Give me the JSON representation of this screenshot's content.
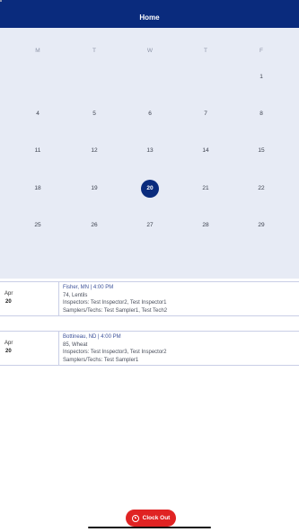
{
  "header": {
    "title": "Home"
  },
  "calendar": {
    "weekdays": [
      "M",
      "T",
      "W",
      "T",
      "F"
    ],
    "weeks": [
      [
        "",
        "",
        "",
        "",
        "1"
      ],
      [
        "4",
        "5",
        "6",
        "7",
        "8"
      ],
      [
        "11",
        "12",
        "13",
        "14",
        "15"
      ],
      [
        "18",
        "19",
        "20",
        "21",
        "22"
      ],
      [
        "25",
        "26",
        "27",
        "28",
        "29"
      ]
    ],
    "selected_day": "20"
  },
  "events": [
    {
      "month": "Apr",
      "day": "20",
      "location_time": "Fisher, MN | 4:00 PM",
      "title": "74, Lentils",
      "inspectors": "Inspectors: Test Inspector2, Test Inspector1",
      "samplers": "Samplers/Techs: Test Sampler1, Test Tech2"
    },
    {
      "month": "Apr",
      "day": "20",
      "location_time": "Bottineau, ND | 4:00 PM",
      "title": "85, Wheat",
      "inspectors": "Inspectors: Test Inspector3, Test Inspector2",
      "samplers": "Samplers/Techs: Test Sampler1"
    }
  ],
  "clock_out": {
    "label": "Clock Out",
    "icon": "clock-icon",
    "color": "#e02323"
  },
  "colors": {
    "brand": "#0a2b7d",
    "calendar_bg": "#e7ebf5"
  }
}
